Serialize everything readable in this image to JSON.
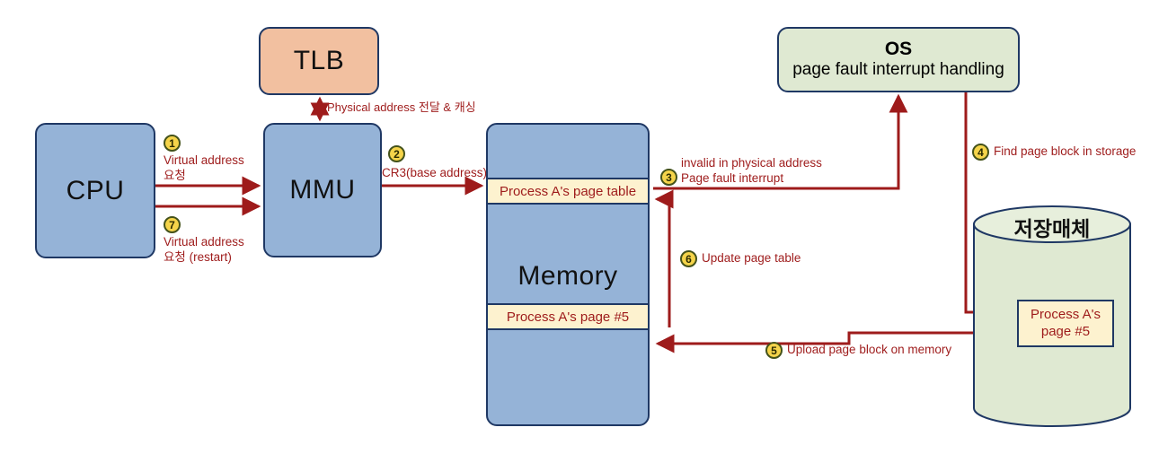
{
  "diagram": {
    "title": "Virtual memory page fault handling flow",
    "colors": {
      "arrow": "#9e1b1b",
      "box_border": "#1f3864",
      "cpu_fill": "#95b3d7",
      "tlb_fill": "#f2c0a0",
      "os_fill": "#dfe9d2",
      "band_fill": "#fdf2cf",
      "badge_fill": "#f5d44a",
      "badge_border": "#44521a"
    }
  },
  "nodes": {
    "cpu": {
      "label": "CPU"
    },
    "mmu": {
      "label": "MMU"
    },
    "tlb": {
      "label": "TLB"
    },
    "memory": {
      "label": "Memory"
    },
    "page_table_band": {
      "label": "Process A's page table"
    },
    "page5_band": {
      "label": "Process A's page #5"
    },
    "os": {
      "title": "OS",
      "subtitle": "page fault interrupt handling"
    },
    "storage": {
      "label": "저장매체"
    },
    "storage_page": {
      "line1": "Process A's",
      "line2": "page #5"
    }
  },
  "steps": [
    {
      "n": "1",
      "text": "Virtual address\n요청"
    },
    {
      "n": "2",
      "text": "CR3(base address)"
    },
    {
      "n": "3",
      "text": "invalid in physical address\nPage fault interrupt"
    },
    {
      "n": "4",
      "text": "Find page block in storage"
    },
    {
      "n": "5",
      "text": "Upload page block on memory"
    },
    {
      "n": "6",
      "text": "Update page table"
    },
    {
      "n": "7",
      "text": "Virtual address\n요청 (restart)"
    }
  ],
  "annotations": {
    "tlb_link": "Physical address 전달 & 캐싱"
  }
}
